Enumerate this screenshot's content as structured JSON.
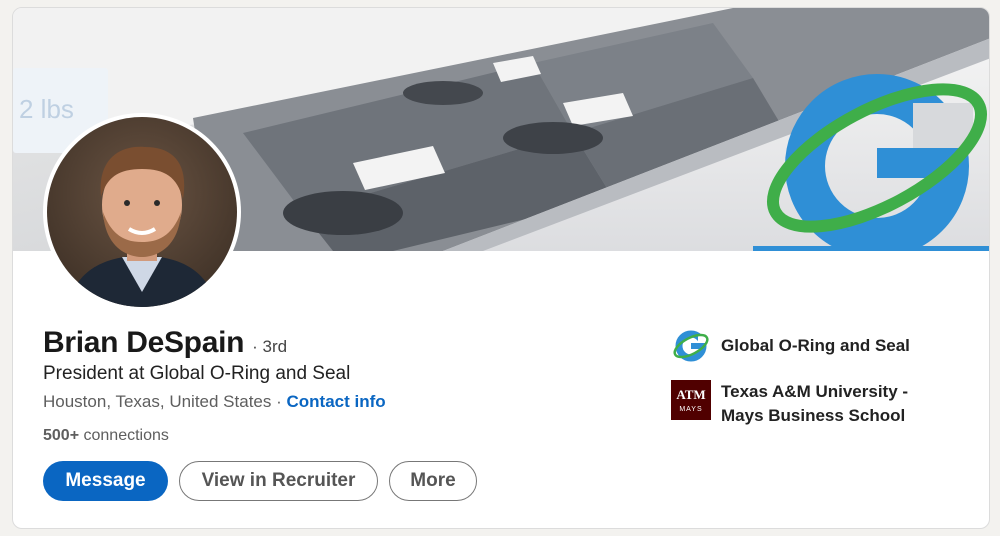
{
  "profile": {
    "name": "Brian DeSpain",
    "degree": "· 3rd",
    "headline": "President at Global O-Ring and Seal",
    "location": "Houston, Texas, United States",
    "separator": "·",
    "contact_label": "Contact info",
    "connections_count": "500+",
    "connections_label": "connections"
  },
  "actions": {
    "message": "Message",
    "recruiter": "View in Recruiter",
    "more": "More"
  },
  "orgs": [
    {
      "name": "Global O-Ring and Seal",
      "logo": "global-oring-logo-icon"
    },
    {
      "name_line1": "Texas A&M University -",
      "name_line2": "Mays Business School",
      "logo": "texas-am-logo-icon",
      "logo_text": "MAYS"
    }
  ],
  "colors": {
    "accent": "#0a66c2",
    "logo_blue": "#2f8fd6",
    "logo_green": "#3fae49",
    "aggie_maroon": "#500000"
  }
}
